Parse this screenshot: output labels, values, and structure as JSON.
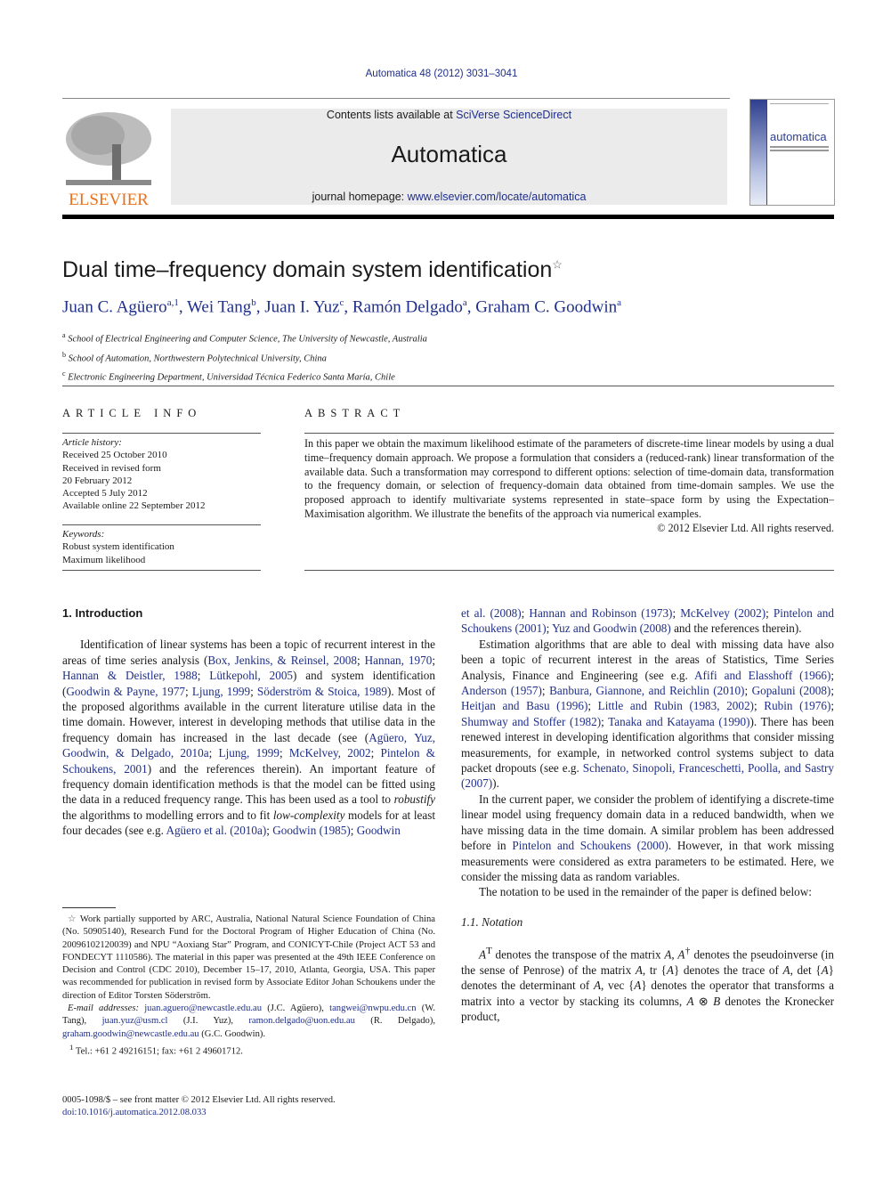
{
  "header": {
    "journal_ref": "Automatica 48 (2012) 3031–3041",
    "contents_prefix": "Contents lists available at ",
    "contents_link": "SciVerse ScienceDirect",
    "journal_title": "Automatica",
    "homepage_prefix": "journal homepage: ",
    "homepage_link": "www.elsevier.com/locate/automatica",
    "publisher_logo_text": "ELSEVIER",
    "cover_title": "automatica"
  },
  "colors": {
    "link": "#1f2f8a",
    "elsevier_orange": "#e9711c",
    "band": "#ebebeb"
  },
  "article": {
    "title": "Dual time–frequency domain system identification",
    "title_mark": "☆",
    "authors": [
      {
        "name": "Juan C. Agüero",
        "sup": "a,1"
      },
      {
        "name": "Wei Tang",
        "sup": "b"
      },
      {
        "name": "Juan I. Yuz",
        "sup": "c"
      },
      {
        "name": "Ramón Delgado",
        "sup": "a"
      },
      {
        "name": "Graham C. Goodwin",
        "sup": "a"
      }
    ],
    "affiliations": [
      {
        "sup": "a",
        "text": "School of Electrical Engineering and Computer Science, The University of Newcastle, Australia"
      },
      {
        "sup": "b",
        "text": "School of Automation, Northwestern Polytechnical University, China"
      },
      {
        "sup": "c",
        "text": "Electronic Engineering Department, Universidad Técnica Federico Santa María, Chile"
      }
    ]
  },
  "article_info": {
    "heading": "ARTICLE INFO",
    "history_label": "Article history:",
    "history": [
      "Received 25 October 2010",
      "Received in revised form",
      "20 February 2012",
      "Accepted 5 July 2012",
      "Available online 22 September 2012"
    ],
    "keywords_label": "Keywords:",
    "keywords": [
      "Robust system identification",
      "Maximum likelihood"
    ]
  },
  "abstract": {
    "heading": "ABSTRACT",
    "text": "In this paper we obtain the maximum likelihood estimate of the parameters of discrete-time linear models by using a dual time–frequency domain approach. We propose a formulation that considers a (reduced-rank) linear transformation of the available data. Such a transformation may correspond to different options: selection of time-domain data, transformation to the frequency domain, or selection of frequency-domain data obtained from time-domain samples. We use the proposed approach to identify multivariate systems represented in state–space form by using the Expectation–Maximisation algorithm. We illustrate the benefits of the approach via numerical examples.",
    "copyright": "© 2012 Elsevier Ltd. All rights reserved."
  },
  "intro": {
    "heading": "1.  Introduction",
    "left_p1": [
      {
        "t": "Identification of linear systems has been a topic of recurrent interest in the areas of time series analysis ("
      },
      {
        "l": "Box, Jenkins, & Reinsel, 2008"
      },
      {
        "t": "; "
      },
      {
        "l": "Hannan, 1970"
      },
      {
        "t": "; "
      },
      {
        "l": "Hannan & Deistler, 1988"
      },
      {
        "t": "; "
      },
      {
        "l": "Lütkepohl, 2005"
      },
      {
        "t": ") and system identification ("
      },
      {
        "l": "Goodwin & Payne, 1977"
      },
      {
        "t": "; "
      },
      {
        "l": "Ljung, 1999"
      },
      {
        "t": "; "
      },
      {
        "l": "Söderström & Stoica, 1989"
      },
      {
        "t": "). Most of the proposed algorithms available in the current literature utilise data in the time domain. However, interest in developing methods that utilise data in the frequency domain has increased in the last decade (see ("
      },
      {
        "l": "Agüero, Yuz, Goodwin, & Delgado, 2010a"
      },
      {
        "t": "; "
      },
      {
        "l": "Ljung, 1999"
      },
      {
        "t": "; "
      },
      {
        "l": "McKelvey, 2002"
      },
      {
        "t": "; "
      },
      {
        "l": "Pintelon & Schoukens, 2001"
      },
      {
        "t": ") and the references therein). An important feature of frequency domain identification methods is that the model can be fitted using the data in a reduced frequency range. This has been used as a tool to "
      },
      {
        "i": "robustify"
      },
      {
        "t": " the algorithms to modelling errors and to fit "
      },
      {
        "i": "low-complexity"
      },
      {
        "t": " models for at least four decades (see e.g. "
      },
      {
        "l": "Agüero et al. (2010a)"
      },
      {
        "t": "; "
      },
      {
        "l": "Goodwin (1985)"
      },
      {
        "t": "; "
      },
      {
        "l": "Goodwin"
      }
    ],
    "right_p0": [
      {
        "l": "et al. (2008)"
      },
      {
        "t": "; "
      },
      {
        "l": "Hannan and Robinson (1973)"
      },
      {
        "t": "; "
      },
      {
        "l": "McKelvey (2002)"
      },
      {
        "t": "; "
      },
      {
        "l": "Pintelon and Schoukens (2001)"
      },
      {
        "t": "; "
      },
      {
        "l": "Yuz and Goodwin (2008)"
      },
      {
        "t": " and the references therein)."
      }
    ],
    "right_p1": [
      {
        "t": "Estimation algorithms that are able to deal with missing data have also been a topic of recurrent interest in the areas of Statistics, Time Series Analysis, Finance and Engineering (see e.g. "
      },
      {
        "l": "Afifi and Elasshoff (1966)"
      },
      {
        "t": "; "
      },
      {
        "l": "Anderson (1957)"
      },
      {
        "t": "; "
      },
      {
        "l": "Banbura, Giannone, and Reichlin (2010)"
      },
      {
        "t": "; "
      },
      {
        "l": "Gopaluni (2008)"
      },
      {
        "t": "; "
      },
      {
        "l": "Heitjan and Basu (1996)"
      },
      {
        "t": "; "
      },
      {
        "l": "Little and Rubin (1983, 2002)"
      },
      {
        "t": "; "
      },
      {
        "l": "Rubin (1976)"
      },
      {
        "t": "; "
      },
      {
        "l": "Shumway and Stoffer (1982)"
      },
      {
        "t": "; "
      },
      {
        "l": "Tanaka and Katayama (1990)"
      },
      {
        "t": "). There has been renewed interest in developing identification algorithms that consider missing measurements, for example, in networked control systems subject to data packet dropouts (see e.g. "
      },
      {
        "l": "Schenato, Sinopoli, Franceschetti, Poolla, and Sastry (2007)"
      },
      {
        "t": ")."
      }
    ],
    "right_p2": [
      {
        "t": "In the current paper, we consider the problem of identifying a discrete-time linear model using frequency domain data in a reduced bandwidth, when we have missing data in the time domain. A similar problem has been addressed before in "
      },
      {
        "l": "Pintelon and Schoukens (2000)"
      },
      {
        "t": ". However, in that work missing measurements were considered as extra parameters to be estimated. Here, we consider the missing data as random variables."
      }
    ],
    "right_p3": "The notation to be used in the remainder of the paper is defined below:",
    "notation_heading": "1.1.  Notation",
    "notation_p": [
      {
        "i": "A"
      },
      {
        "s": "T"
      },
      {
        "t": " denotes the transpose of the matrix "
      },
      {
        "i": "A"
      },
      {
        "t": ", "
      },
      {
        "i": "A"
      },
      {
        "s": "†"
      },
      {
        "t": " denotes the pseudoinverse (in the sense of Penrose) of the matrix "
      },
      {
        "i": "A"
      },
      {
        "t": ", tr {"
      },
      {
        "i": "A"
      },
      {
        "t": "} denotes the trace of "
      },
      {
        "i": "A"
      },
      {
        "t": ", det {"
      },
      {
        "i": "A"
      },
      {
        "t": "} denotes the determinant of "
      },
      {
        "i": "A"
      },
      {
        "t": ", vec {"
      },
      {
        "i": "A"
      },
      {
        "t": "} denotes the operator that transforms a matrix into a vector by stacking its columns, "
      },
      {
        "i": "A"
      },
      {
        "t": " ⊗ "
      },
      {
        "i": "B"
      },
      {
        "t": " denotes the Kronecker product,"
      }
    ]
  },
  "footnotes": {
    "star": "Work partially supported by ARC, Australia, National Natural Science Foundation of China (No. 50905140), Research Fund for the Doctoral Program of Higher Education of China (No. 20096102120039) and NPU “Aoxiang Star” Program, and CONICYT-Chile (Project ACT 53 and FONDECYT 1110586). The material in this paper was presented at the 49th IEEE Conference on Decision and Control (CDC 2010), December 15–17, 2010, Atlanta, Georgia, USA. This paper was recommended for publication in revised form by Associate Editor Johan Schoukens under the direction of Editor Torsten Söderström.",
    "email_label": "E-mail addresses:",
    "emails": [
      {
        "addr": "juan.aguero@newcastle.edu.au",
        "who": " (J.C. Agüero),"
      },
      {
        "addr": "tangwei@nwpu.edu.cn",
        "who": " (W. Tang), "
      },
      {
        "addr": "juan.yuz@usm.cl",
        "who": " (J.I. Yuz),"
      },
      {
        "addr": "ramon.delgado@uon.edu.au",
        "who": " (R. Delgado), "
      },
      {
        "addr": "graham.goodwin@newcastle.edu.au",
        "who": ""
      }
    ],
    "email_tail": "(G.C. Goodwin).",
    "fn1_mark": "1",
    "fn1": "Tel.: +61 2 49216151; fax: +61 2 49601712."
  },
  "bottom": {
    "issn": "0005-1098/$ – see front matter © 2012 Elsevier Ltd. All rights reserved.",
    "doi": "doi:10.1016/j.automatica.2012.08.033"
  }
}
